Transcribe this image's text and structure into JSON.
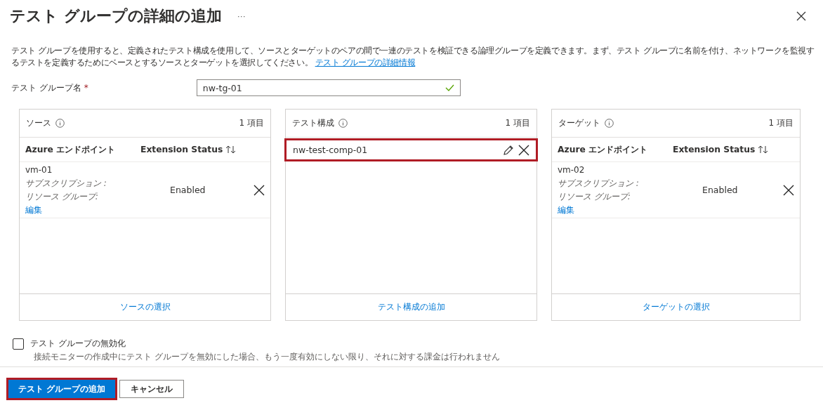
{
  "title": "テスト グループの詳細の追加",
  "more": "···",
  "description": {
    "text": "テスト グループを使用すると、定義されたテスト構成を使用して、ソースとターゲットのペアの間で一連のテストを検証できる論理グループを定義できます。まず、テスト グループに名前を付け、ネットワークを監視するテストを定義するためにベースとするソースとターゲットを選択してください。",
    "link": "テスト グループの詳細情報"
  },
  "name_field": {
    "label": "テスト グループ名",
    "required_mark": "*",
    "value": "nw-tg-01",
    "valid": true
  },
  "panels": [
    {
      "kind": "endpoints",
      "title": "ソース",
      "count": "1 項目",
      "columns": [
        "Azure エンドポイント",
        "Extension Status"
      ],
      "rows": [
        {
          "name": "vm-01",
          "subscription": "サブスクリプション :",
          "resource_group": "リソース グループ:",
          "edit": "編集",
          "status": "Enabled"
        }
      ],
      "footer": "ソースの選択"
    },
    {
      "kind": "configs",
      "title": "テスト構成",
      "count": "1 項目",
      "items": [
        {
          "name": "nw-test-comp-01",
          "highlighted": true
        }
      ],
      "footer": "テスト構成の追加"
    },
    {
      "kind": "endpoints",
      "title": "ターゲット",
      "count": "1 項目",
      "columns": [
        "Azure エンドポイント",
        "Extension Status"
      ],
      "rows": [
        {
          "name": "vm-02",
          "subscription": "サブスクリプション :",
          "resource_group": "リソース グループ:",
          "edit": "編集",
          "status": "Enabled"
        }
      ],
      "footer": "ターゲットの選択"
    }
  ],
  "disable": {
    "label": "テスト グループの無効化",
    "checked": false,
    "hint": "接続モニターの作成中にテスト グループを無効にした場合、もう一度有効にしない限り、それに対する課金は行われません"
  },
  "buttons": [
    {
      "label": "テスト グループの追加",
      "kind": "primary",
      "highlighted": true
    },
    {
      "label": "キャンセル",
      "kind": "secondary",
      "highlighted": false
    }
  ]
}
